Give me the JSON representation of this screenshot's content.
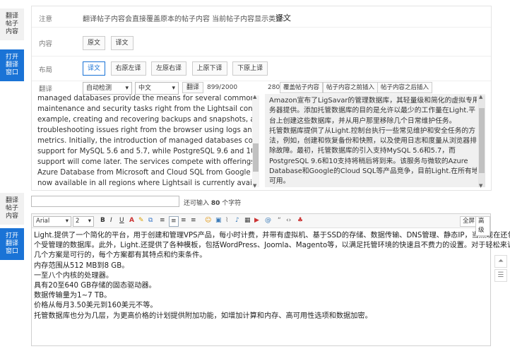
{
  "side_tabs": {
    "translate_top": [
      "翻译",
      "帖子",
      "内容"
    ],
    "open_top": [
      "打开",
      "翻译",
      "窗口"
    ],
    "translate_bottom": [
      "翻译",
      "帖子",
      "内容"
    ],
    "open_bottom": [
      "打开",
      "翻译",
      "窗口"
    ]
  },
  "notice": {
    "label": "注意",
    "text": "翻译帖子内容会直接覆盖原本的帖子内容   当前帖子内容显示类型:",
    "type": "译文"
  },
  "content": {
    "label": "内容",
    "buttons": [
      "原文",
      "译文"
    ]
  },
  "layout": {
    "label": "布局",
    "buttons": [
      "译文",
      "右原左译",
      "左原右译",
      "上原下译",
      "下原上译"
    ]
  },
  "translate": {
    "label": "翻译",
    "source_lang": "自动检测",
    "target_lang": "中文",
    "translate_button": "翻译",
    "char_count": "899/2000",
    "right_count": "280",
    "right_buttons": [
      "覆盖帖子内容",
      "帖子内容之前插入",
      "帖子内容之后插入"
    ]
  },
  "source_lines": [
    "managed databases provide the means for several common",
    "maintenance and security tasks right from the Lightsail console, for",
    "example, creating and recovering backups and snapshots, as well as",
    "troubleshooting issues right from the browser using logs and",
    "metrics. Initially, the introduction of managed databases comes with",
    "support for MySQL 5.6 and 5.7, while PostgreSQL 9.6 and 10",
    "support will come later. The services compete with offerings like",
    "Azure Database from Microsoft and Cloud SQL from Google and is",
    "now available in all regions where Lightsail is currently available."
  ],
  "translated_lines": [
    "Amazon宣布了LigSavar的管理数据库，其轻量级和简化的虚拟专用服",
    "务器提供。添加托管数据库的目的是允许以最少的工作量在Light.平",
    "台上创建这些数据库，并从用户那里移除几个日常维护任务。",
    "托管数据库提供了从Light.控制台执行一些常见维护和安全任务的方",
    "法，例如，创建和恢复备份和快照，以及使用日志和度量从浏览器排",
    "除故障。最初，托管数据库的引入支持MySQL 5.6和5.7，而",
    "PostgreSQL 9.6和10支持将稍后将到来。该服务与微软的Azure",
    "Database和Google的Cloud SQL等产品竞争，目前Light.在所有地区都",
    "可用。"
  ],
  "counter": {
    "prefix": "还可输入",
    "count": "80",
    "suffix": "个字符"
  },
  "editor": {
    "font": "Arial",
    "size": "2",
    "fullscreen": "全屏",
    "advanced": "高级",
    "lines": [
      "Light.提供了一个简化的平台，用于创建和管理VPS产品，每小时计费，并带有虚拟机、基于SSD的存储、数据传输、DNS管理、静态IP，当然现在还包括一",
      "个受管理的数据库。此外，Light.还提供了各种模板，包括WordPress、Joomla、Magento等，以满足托管环境的快速且不费力的设置。对于轻松来说，有",
      "几个方案是可行的，每个方案都有其特点和约束条件。",
      "内存范围从512 MB到8 GB。",
      "一至八个内核的处理器。",
      "具有20至640 GB存储的固态驱动器。",
      "数据传输量为1~7 TB。",
      "价格从每月3.50美元到160美元不等。",
      "托管数据库也分为几层，为更高价格的计划提供附加功能，如增加计算和内存、高可用性选项和数据加密。"
    ]
  },
  "icons": {
    "bold": "B",
    "italic": "I",
    "underline": "U",
    "top_button": "⏶",
    "list_button": "☰"
  }
}
